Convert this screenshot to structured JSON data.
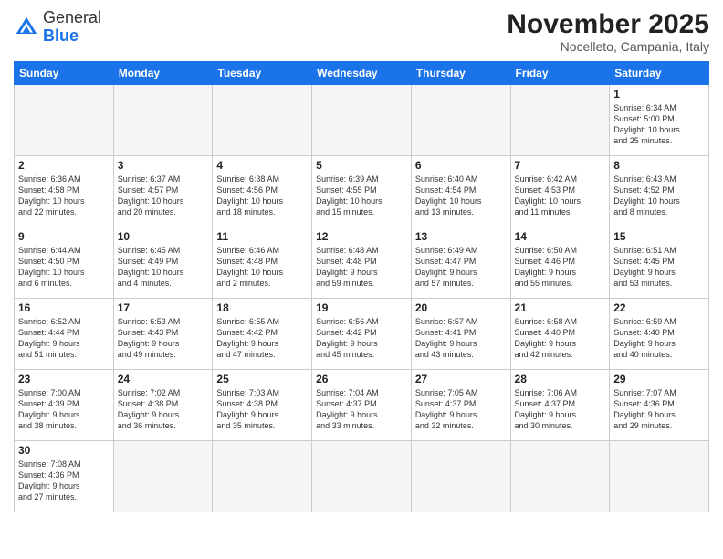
{
  "header": {
    "logo_general": "General",
    "logo_blue": "Blue",
    "title": "November 2025",
    "subtitle": "Nocelleto, Campania, Italy"
  },
  "weekdays": [
    "Sunday",
    "Monday",
    "Tuesday",
    "Wednesday",
    "Thursday",
    "Friday",
    "Saturday"
  ],
  "days": [
    {
      "num": "",
      "info": "",
      "empty": true
    },
    {
      "num": "",
      "info": "",
      "empty": true
    },
    {
      "num": "",
      "info": "",
      "empty": true
    },
    {
      "num": "",
      "info": "",
      "empty": true
    },
    {
      "num": "",
      "info": "",
      "empty": true
    },
    {
      "num": "",
      "info": "",
      "empty": true
    },
    {
      "num": "1",
      "info": "Sunrise: 6:34 AM\nSunset: 5:00 PM\nDaylight: 10 hours\nand 25 minutes.",
      "empty": false
    },
    {
      "num": "2",
      "info": "Sunrise: 6:36 AM\nSunset: 4:58 PM\nDaylight: 10 hours\nand 22 minutes.",
      "empty": false
    },
    {
      "num": "3",
      "info": "Sunrise: 6:37 AM\nSunset: 4:57 PM\nDaylight: 10 hours\nand 20 minutes.",
      "empty": false
    },
    {
      "num": "4",
      "info": "Sunrise: 6:38 AM\nSunset: 4:56 PM\nDaylight: 10 hours\nand 18 minutes.",
      "empty": false
    },
    {
      "num": "5",
      "info": "Sunrise: 6:39 AM\nSunset: 4:55 PM\nDaylight: 10 hours\nand 15 minutes.",
      "empty": false
    },
    {
      "num": "6",
      "info": "Sunrise: 6:40 AM\nSunset: 4:54 PM\nDaylight: 10 hours\nand 13 minutes.",
      "empty": false
    },
    {
      "num": "7",
      "info": "Sunrise: 6:42 AM\nSunset: 4:53 PM\nDaylight: 10 hours\nand 11 minutes.",
      "empty": false
    },
    {
      "num": "8",
      "info": "Sunrise: 6:43 AM\nSunset: 4:52 PM\nDaylight: 10 hours\nand 8 minutes.",
      "empty": false
    },
    {
      "num": "9",
      "info": "Sunrise: 6:44 AM\nSunset: 4:50 PM\nDaylight: 10 hours\nand 6 minutes.",
      "empty": false
    },
    {
      "num": "10",
      "info": "Sunrise: 6:45 AM\nSunset: 4:49 PM\nDaylight: 10 hours\nand 4 minutes.",
      "empty": false
    },
    {
      "num": "11",
      "info": "Sunrise: 6:46 AM\nSunset: 4:48 PM\nDaylight: 10 hours\nand 2 minutes.",
      "empty": false
    },
    {
      "num": "12",
      "info": "Sunrise: 6:48 AM\nSunset: 4:48 PM\nDaylight: 9 hours\nand 59 minutes.",
      "empty": false
    },
    {
      "num": "13",
      "info": "Sunrise: 6:49 AM\nSunset: 4:47 PM\nDaylight: 9 hours\nand 57 minutes.",
      "empty": false
    },
    {
      "num": "14",
      "info": "Sunrise: 6:50 AM\nSunset: 4:46 PM\nDaylight: 9 hours\nand 55 minutes.",
      "empty": false
    },
    {
      "num": "15",
      "info": "Sunrise: 6:51 AM\nSunset: 4:45 PM\nDaylight: 9 hours\nand 53 minutes.",
      "empty": false
    },
    {
      "num": "16",
      "info": "Sunrise: 6:52 AM\nSunset: 4:44 PM\nDaylight: 9 hours\nand 51 minutes.",
      "empty": false
    },
    {
      "num": "17",
      "info": "Sunrise: 6:53 AM\nSunset: 4:43 PM\nDaylight: 9 hours\nand 49 minutes.",
      "empty": false
    },
    {
      "num": "18",
      "info": "Sunrise: 6:55 AM\nSunset: 4:42 PM\nDaylight: 9 hours\nand 47 minutes.",
      "empty": false
    },
    {
      "num": "19",
      "info": "Sunrise: 6:56 AM\nSunset: 4:42 PM\nDaylight: 9 hours\nand 45 minutes.",
      "empty": false
    },
    {
      "num": "20",
      "info": "Sunrise: 6:57 AM\nSunset: 4:41 PM\nDaylight: 9 hours\nand 43 minutes.",
      "empty": false
    },
    {
      "num": "21",
      "info": "Sunrise: 6:58 AM\nSunset: 4:40 PM\nDaylight: 9 hours\nand 42 minutes.",
      "empty": false
    },
    {
      "num": "22",
      "info": "Sunrise: 6:59 AM\nSunset: 4:40 PM\nDaylight: 9 hours\nand 40 minutes.",
      "empty": false
    },
    {
      "num": "23",
      "info": "Sunrise: 7:00 AM\nSunset: 4:39 PM\nDaylight: 9 hours\nand 38 minutes.",
      "empty": false
    },
    {
      "num": "24",
      "info": "Sunrise: 7:02 AM\nSunset: 4:38 PM\nDaylight: 9 hours\nand 36 minutes.",
      "empty": false
    },
    {
      "num": "25",
      "info": "Sunrise: 7:03 AM\nSunset: 4:38 PM\nDaylight: 9 hours\nand 35 minutes.",
      "empty": false
    },
    {
      "num": "26",
      "info": "Sunrise: 7:04 AM\nSunset: 4:37 PM\nDaylight: 9 hours\nand 33 minutes.",
      "empty": false
    },
    {
      "num": "27",
      "info": "Sunrise: 7:05 AM\nSunset: 4:37 PM\nDaylight: 9 hours\nand 32 minutes.",
      "empty": false
    },
    {
      "num": "28",
      "info": "Sunrise: 7:06 AM\nSunset: 4:37 PM\nDaylight: 9 hours\nand 30 minutes.",
      "empty": false
    },
    {
      "num": "29",
      "info": "Sunrise: 7:07 AM\nSunset: 4:36 PM\nDaylight: 9 hours\nand 29 minutes.",
      "empty": false
    },
    {
      "num": "30",
      "info": "Sunrise: 7:08 AM\nSunset: 4:36 PM\nDaylight: 9 hours\nand 27 minutes.",
      "empty": false
    },
    {
      "num": "",
      "info": "",
      "empty": true
    },
    {
      "num": "",
      "info": "",
      "empty": true
    },
    {
      "num": "",
      "info": "",
      "empty": true
    },
    {
      "num": "",
      "info": "",
      "empty": true
    },
    {
      "num": "",
      "info": "",
      "empty": true
    },
    {
      "num": "",
      "info": "",
      "empty": true
    }
  ]
}
